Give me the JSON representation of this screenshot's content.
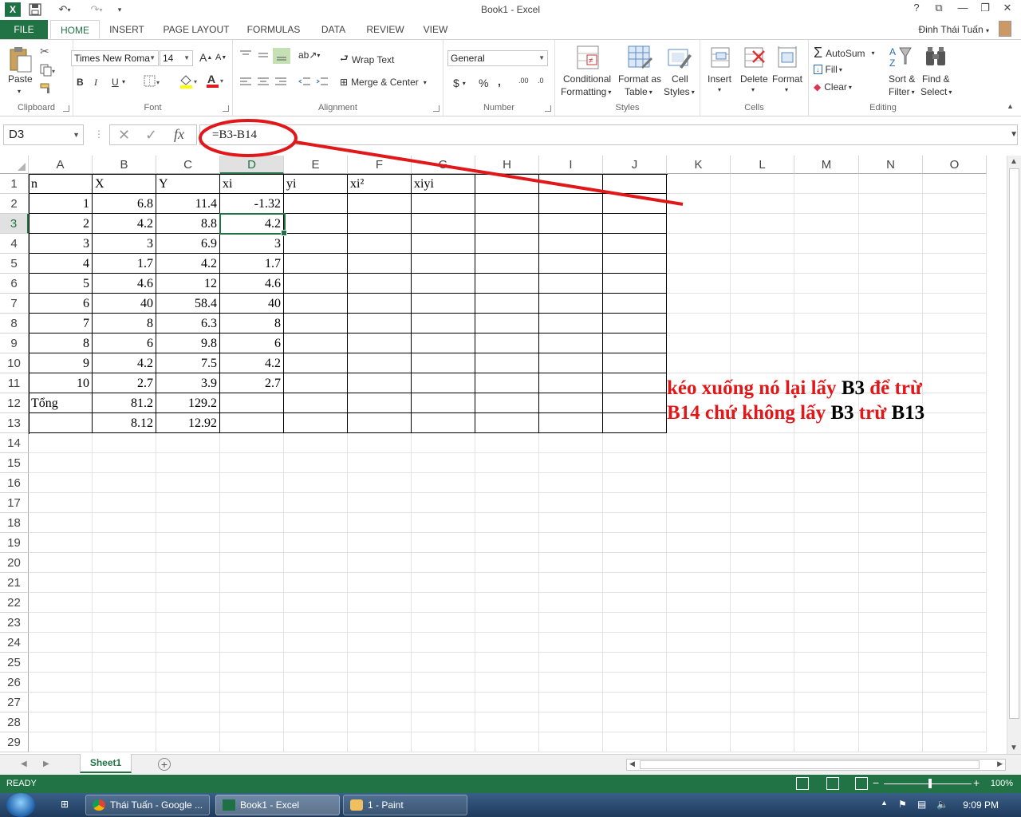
{
  "window": {
    "title": "Book1 - Excel",
    "help": "?",
    "restore_ribbon": "⧉",
    "minimize": "—",
    "maximize": "❐",
    "close": "✕"
  },
  "tabs": [
    "FILE",
    "HOME",
    "INSERT",
    "PAGE LAYOUT",
    "FORMULAS",
    "DATA",
    "REVIEW",
    "VIEW"
  ],
  "user": {
    "name": "Đinh Thái Tuấn"
  },
  "ribbon": {
    "clipboard": {
      "label": "Clipboard",
      "paste": "Paste"
    },
    "font": {
      "label": "Font",
      "name": "Times New Roma",
      "size": "14",
      "grow": "A",
      "shrink": "A",
      "bold": "B",
      "italic": "I",
      "underline": "U"
    },
    "alignment": {
      "label": "Alignment",
      "wrap": "Wrap Text",
      "merge": "Merge & Center"
    },
    "number": {
      "label": "Number",
      "format": "General",
      "currency": "$",
      "percent": "%",
      "comma": ",",
      "inc_dec": ".00",
      "dec_dec": ".0"
    },
    "styles": {
      "label": "Styles",
      "conditional_1": "Conditional",
      "conditional_2": "Formatting",
      "format_table_1": "Format as",
      "format_table_2": "Table",
      "cell_styles_1": "Cell",
      "cell_styles_2": "Styles"
    },
    "cells": {
      "label": "Cells",
      "insert": "Insert",
      "delete": "Delete",
      "format": "Format"
    },
    "editing": {
      "label": "Editing",
      "autosum": "AutoSum",
      "fill": "Fill",
      "clear": "Clear",
      "sort_1": "Sort &",
      "sort_2": "Filter",
      "find_1": "Find &",
      "find_2": "Select"
    }
  },
  "formula_bar": {
    "name_box": "D3",
    "formula": "=B3-B14",
    "cancel": "✕",
    "enter": "✓",
    "fx": "fx"
  },
  "columns": [
    "A",
    "B",
    "C",
    "D",
    "E",
    "F",
    "G",
    "H",
    "I",
    "J",
    "K",
    "L",
    "M",
    "N",
    "O"
  ],
  "rows": [
    "1",
    "2",
    "3",
    "4",
    "5",
    "6",
    "7",
    "8",
    "9",
    "10",
    "11",
    "12",
    "13",
    "14",
    "15",
    "16",
    "17",
    "18",
    "19",
    "20",
    "21",
    "22",
    "23",
    "24",
    "25",
    "26",
    "27",
    "28",
    "29"
  ],
  "sheet_data": [
    [
      "n",
      "X",
      "Y",
      "xi",
      "yi",
      "xi²",
      "xiyi"
    ],
    [
      "1",
      "6.8",
      "11.4",
      "-1.32"
    ],
    [
      "2",
      "4.2",
      "8.8",
      "4.2"
    ],
    [
      "3",
      "3",
      "6.9",
      "3"
    ],
    [
      "4",
      "1.7",
      "4.2",
      "1.7"
    ],
    [
      "5",
      "4.6",
      "12",
      "4.6"
    ],
    [
      "6",
      "40",
      "58.4",
      "40"
    ],
    [
      "7",
      "8",
      "6.3",
      "8"
    ],
    [
      "8",
      "6",
      "9.8",
      "6"
    ],
    [
      "9",
      "4.2",
      "7.5",
      "4.2"
    ],
    [
      "10",
      "2.7",
      "3.9",
      "2.7"
    ],
    [
      "Tổng",
      "81.2",
      "129.2",
      ""
    ],
    [
      "",
      "8.12",
      "12.92",
      ""
    ]
  ],
  "annotation": {
    "line1": [
      {
        "t": "kéo xuống nó lại lấy ",
        "k": false
      },
      {
        "t": "B3",
        "k": true
      },
      {
        "t": " để trừ",
        "k": false
      }
    ],
    "line2": [
      {
        "t": "B14 chứ không lấy ",
        "k": false
      },
      {
        "t": "B3",
        "k": true
      },
      {
        "t": " trừ ",
        "k": false
      },
      {
        "t": "B13",
        "k": true
      }
    ]
  },
  "sheet_tabs": {
    "active": "Sheet1",
    "add": "+"
  },
  "status": {
    "text": "READY",
    "zoom": "100%",
    "minus": "−",
    "plus": "+"
  },
  "taskbar": {
    "items": [
      "Thái Tuấn - Google ...",
      "Book1 - Excel",
      "1 - Paint"
    ],
    "clock": "9:09 PM"
  },
  "colors": {
    "excel_green": "#217346",
    "annotation_red": "#e0181a"
  }
}
